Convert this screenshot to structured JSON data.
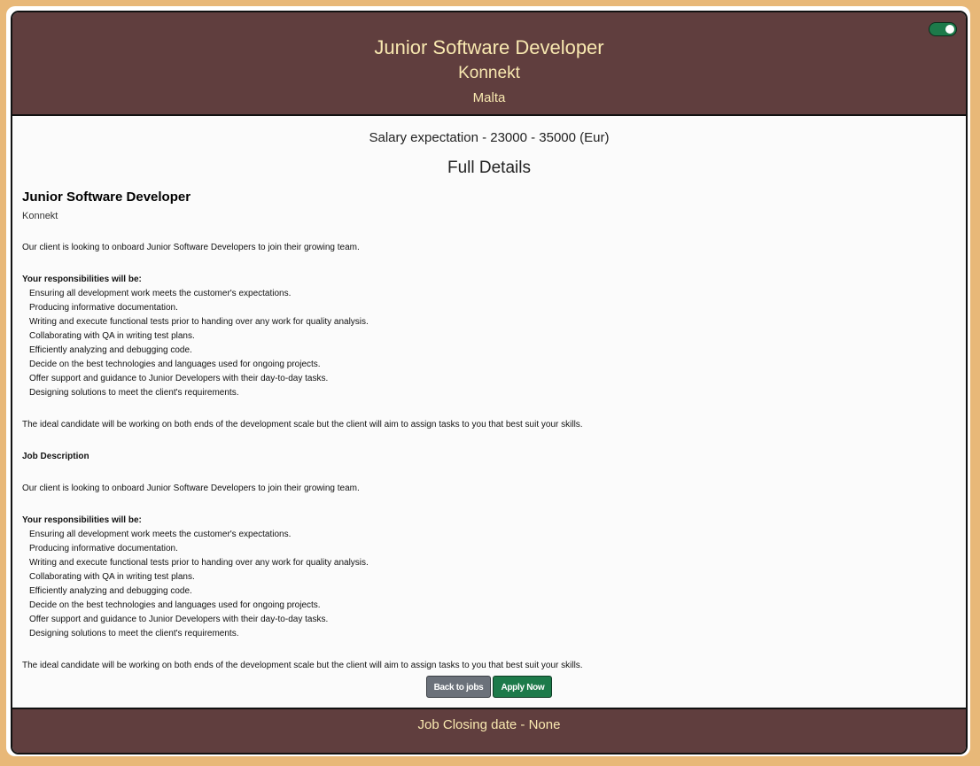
{
  "header": {
    "title": "Junior Software Developer",
    "company": "Konnekt",
    "location": "Malta",
    "toggle_state": "on"
  },
  "body": {
    "salary": "Salary expectation - 23000 - 35000 (Eur)",
    "full_details_heading": "Full Details",
    "detail_title": "Junior Software Developer",
    "detail_company": "Konnekt",
    "intro": "Our client is looking to onboard Junior Software Developers to join their growing team.",
    "responsibilities_heading": "Your responsibilities will be:",
    "responsibilities": [
      "Ensuring all development work meets the customer's expectations.",
      "Producing informative documentation.",
      "Writing and execute functional tests prior to handing over any work for quality analysis.",
      "Collaborating with QA in writing test plans.",
      "Efficiently analyzing and debugging code.",
      "Decide on the best technologies and languages used for ongoing projects.",
      "Offer support and guidance to Junior Developers with their day-to-day tasks.",
      "Designing solutions to meet the client's requirements."
    ],
    "ideal_candidate": "The ideal candidate will be working on both ends of the development scale but the client will aim to assign tasks to you that best suit your skills.",
    "job_description_heading": "Job Description",
    "intro_2": "Our client is looking to onboard Junior Software Developers to join their growing team.",
    "responsibilities_heading_2": "Your responsibilities will be:",
    "responsibilities_2": [
      "Ensuring all development work meets the customer's expectations.",
      "Producing informative documentation.",
      "Writing and execute functional tests prior to handing over any work for quality analysis.",
      "Collaborating with QA in writing test plans.",
      "Efficiently analyzing and debugging code.",
      "Decide on the best technologies and languages used for ongoing projects.",
      "Offer support and guidance to Junior Developers with their day-to-day tasks.",
      "Designing solutions to meet the client's requirements."
    ],
    "ideal_candidate_2": "The ideal candidate will be working on both ends of the development scale but the client will aim to assign tasks to you that best suit your skills."
  },
  "actions": {
    "back_label": "Back to jobs",
    "apply_label": "Apply Now"
  },
  "footer": {
    "closing": "Job Closing date - None"
  },
  "colors": {
    "page_background": "#e8b878",
    "header_background": "#603e3e",
    "header_text": "#f8e8b0",
    "apply_button": "#1d7a4a",
    "back_button": "#6b717a"
  }
}
